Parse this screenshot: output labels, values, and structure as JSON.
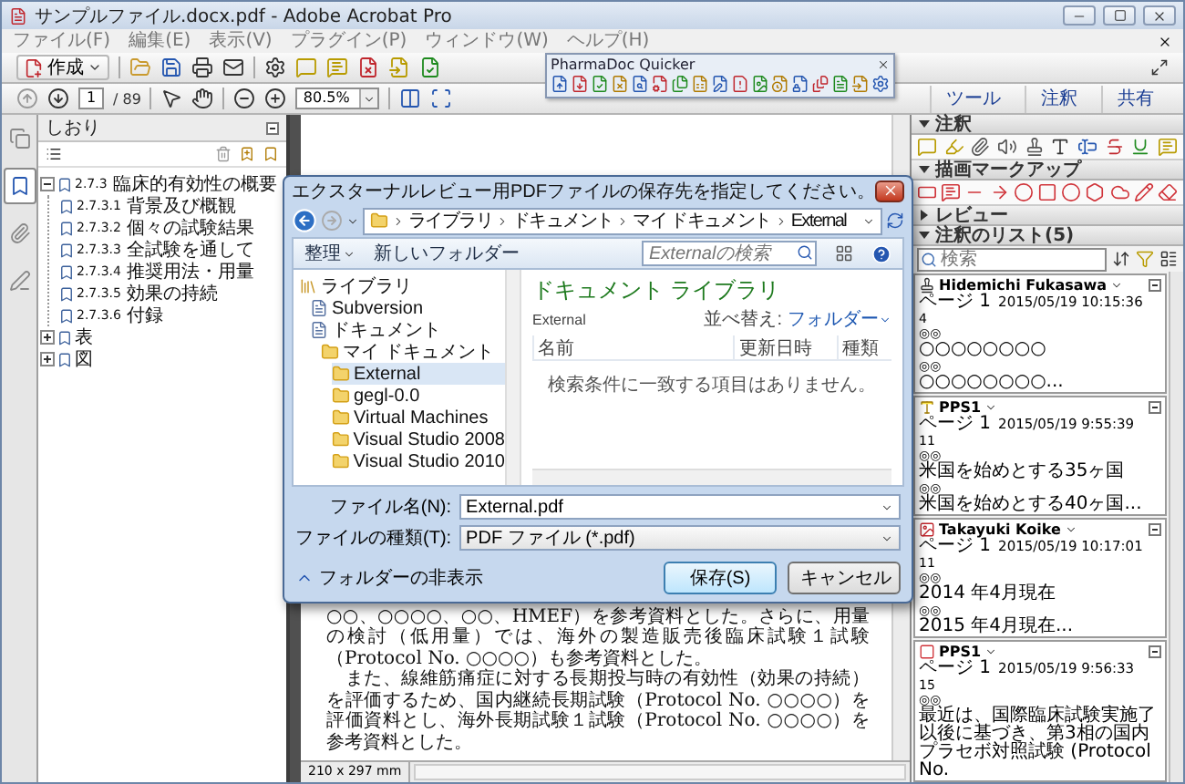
{
  "window": {
    "title": "サンプルファイル.docx.pdf - Adobe Acrobat Pro"
  },
  "menu": [
    "ファイル(F)",
    "編集(E)",
    "表示(V)",
    "プラグイン(P)",
    "ウィンドウ(W)",
    "ヘルプ(H)"
  ],
  "toolbar": {
    "create": "作成",
    "page": "1",
    "page_count": "/ 89",
    "zoom": "80.5%",
    "panes": [
      "ツール",
      "注釈",
      "共有"
    ]
  },
  "quicker": {
    "title": "PharmaDoc Quicker"
  },
  "nav_tabs": [
    {
      "kind": "pages",
      "selected": false
    },
    {
      "kind": "bookmarks",
      "selected": true
    },
    {
      "kind": "attachments",
      "selected": false
    },
    {
      "kind": "signatures",
      "selected": false
    }
  ],
  "bookmarks": {
    "title": "しおり",
    "items": [
      {
        "number": "2.7.3",
        "title": "臨床的有効性の概要",
        "expanded": true,
        "children": [
          {
            "number": "2.7.3.1",
            "title": "背景及び概観"
          },
          {
            "number": "2.7.3.2",
            "title": "個々の試験結果"
          },
          {
            "number": "2.7.3.3",
            "title": "全試験を通して"
          },
          {
            "number": "2.7.3.4",
            "title": "推奨用法・用量"
          },
          {
            "number": "2.7.3.5",
            "title": "効果の持続"
          },
          {
            "number": "2.7.3.6",
            "title": "付録"
          }
        ]
      },
      {
        "title": "表",
        "expanded": false
      },
      {
        "title": "図",
        "expanded": false
      }
    ]
  },
  "document": {
    "paragraphs": [
      "○○、○○○○、○○、HMEF）を参考資料とした。さらに、用量の検討（低用量）では、海外の製造販売後臨床試験１試験（Protocol No. ○○○○）も参考資料とした。",
      "　また、線維筋痛症に対する長期投与時の有効性（効果の持続）を評価するため、国内継続長期試験（Protocol No. ○○○○）を評価資料とし、海外長期試験１試験（Protocol No. ○○○○）を参考資料とした。"
    ],
    "page_size": "210 x 297 mm"
  },
  "right_panel": {
    "sections": [
      {
        "title": "注釈",
        "expanded": true,
        "kind": "comment_tools"
      },
      {
        "title": "描画マークアップ",
        "expanded": true,
        "kind": "drawing_tools"
      },
      {
        "title": "レビュー",
        "expanded": false,
        "kind": "review"
      },
      {
        "title": "注釈のリスト(5)",
        "expanded": true,
        "kind": "comment_list"
      }
    ],
    "search_placeholder": "検索",
    "comments": [
      {
        "kind": "stamp",
        "author": "Hidemichi Fukasawa",
        "page": "ページ 1",
        "date": "2015/05/19 10:15:36",
        "number": "4",
        "entries": [
          {
            "marker": "◎◎",
            "text": "○○○○○○○○"
          },
          {
            "marker": "◎◎",
            "text": "○○○○○○○○..."
          }
        ]
      },
      {
        "kind": "text",
        "author": "PPS1",
        "page": "ページ 1",
        "date": "2015/05/19 9:55:39",
        "number": "11",
        "entries": [
          {
            "marker": "◎◎",
            "text": "米国を始めとする35ヶ国"
          },
          {
            "marker": "◎◎",
            "text": "米国を始めとする40ヶ国..."
          }
        ]
      },
      {
        "kind": "image",
        "author": "Takayuki Koike",
        "page": "ページ 1",
        "date": "2015/05/19 10:17:01",
        "number": "11",
        "entries": [
          {
            "marker": "◎◎",
            "text": "2014 年4月現在"
          },
          {
            "marker": "◎◎",
            "text": "2015 年4月現在..."
          }
        ]
      },
      {
        "kind": "square",
        "author": "PPS1",
        "page": "ページ 1",
        "date": "2015/05/19 9:56:33",
        "number": "15",
        "entries": [
          {
            "marker": "◎◎",
            "text": "最近は、国際臨床試験実施了以後に基づき、第3相の国内プラセボ対照試験 (Protocol No."
          }
        ]
      }
    ]
  },
  "dialog": {
    "title": "エクスターナルレビュー用PDFファイルの保存先を指定してください。",
    "path": [
      "ライブラリ",
      "ドキュメント",
      "マイ ドキュメント",
      "External"
    ],
    "search_placeholder": "Externalの検索",
    "organize": "整理",
    "new_folder": "新しいフォルダー",
    "tree": [
      {
        "label": "ライブラリ",
        "kind": "library",
        "selected": false,
        "children": [
          {
            "label": "Subversion",
            "kind": "document",
            "selected": false
          },
          {
            "label": "ドキュメント",
            "kind": "document",
            "selected": false,
            "children": [
              {
                "label": "マイ ドキュメント",
                "kind": "folder",
                "selected": false,
                "children": [
                  {
                    "label": "External",
                    "kind": "folder",
                    "selected": true
                  },
                  {
                    "label": "gegl-0.0",
                    "kind": "folder",
                    "selected": false
                  },
                  {
                    "label": "Virtual Machines",
                    "kind": "folder",
                    "selected": false
                  },
                  {
                    "label": "Visual Studio 2008",
                    "kind": "folder",
                    "selected": false
                  },
                  {
                    "label": "Visual Studio 2010",
                    "kind": "folder",
                    "selected": false
                  }
                ]
              }
            ]
          }
        ]
      }
    ],
    "library_title": "ドキュメント ライブラリ",
    "library_subtitle": "External",
    "sort_label": "並べ替え:",
    "sort_value": "フォルダー",
    "columns": [
      "名前",
      "更新日時",
      "種類"
    ],
    "empty_message": "検索条件に一致する項目はありません。",
    "fields": [
      {
        "label": "ファイル名(N):",
        "value": "External.pdf"
      },
      {
        "label": "ファイルの種類(T):",
        "value": "PDF ファイル (*.pdf)"
      }
    ],
    "hide_folders": "フォルダーの非表示",
    "buttons": [
      {
        "label": "保存(S)",
        "default": true
      },
      {
        "label": "キャンセル",
        "default": false
      }
    ]
  }
}
